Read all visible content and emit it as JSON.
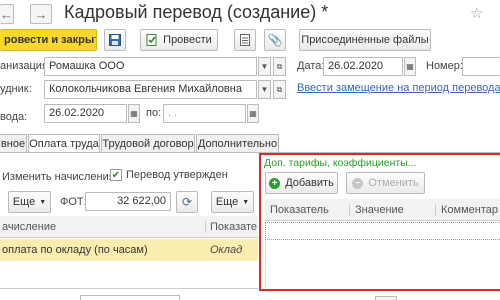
{
  "window": {
    "title": "Кадровый перевод (создание) *",
    "favorite_star": "☆",
    "back_icon": "arrow-left",
    "forward_icon": "arrow-right"
  },
  "toolbar": {
    "post_and_close": "ровести и закрыть",
    "save_icon": "floppy-disk",
    "post": "Провести",
    "attached_files": "Присоединенные файлы"
  },
  "form": {
    "organization_label": "анизация:",
    "organization_value": "Ромашка ООО",
    "employee_label": "удник:",
    "employee_value": "Колокольчикова Евгения Михайловна",
    "transfer_label": "вода:",
    "transfer_from": "26.02.2020",
    "transfer_to_label": "по:",
    "transfer_to": ". .",
    "date_label": "Дата:",
    "date_value": "26.02.2020",
    "number_label": "Номер:",
    "number_value": "",
    "replacement_link": "Ввести замещение на период перевода"
  },
  "tabs": [
    "вное",
    "Оплата труда",
    "Трудовой договор",
    "Дополнительно"
  ],
  "pay": {
    "change_accruals": "Изменить начисления",
    "transfer_approved": "Перевод утвержден",
    "more_label": "Еще",
    "fot_label": "ФОТ:",
    "fot_value": "32 622,00",
    "col_accrual": "ачисление",
    "col_indicator": "Показате",
    "row_accrual": "оплата по окладу (по часам)",
    "row_indicator": "Оклад"
  },
  "extra": {
    "header": "Доп. тарифы, коэффициенты...",
    "add": "Добавить",
    "cancel": "Отменить",
    "col_indicator": "Показатель",
    "col_value": "Значение",
    "col_comment": "Комментар"
  },
  "colors": {
    "primary": "#fbd72c",
    "highlight_row": "#fbedb0",
    "frame": "#e0262b",
    "link": "#3a64b4",
    "green": "#2d8a2d"
  }
}
